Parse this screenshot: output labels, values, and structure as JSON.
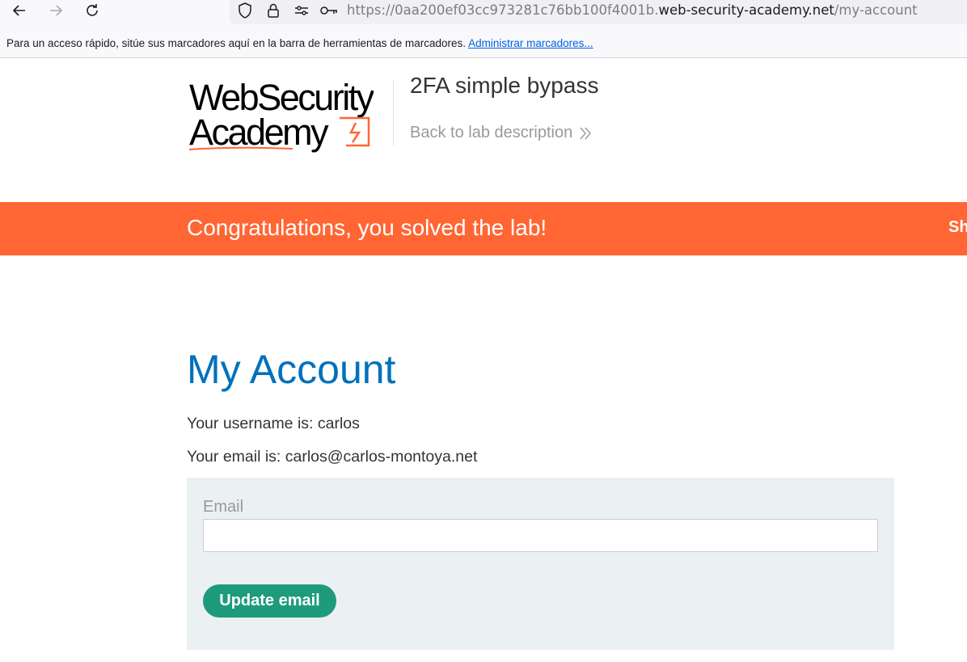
{
  "browser": {
    "url_prefix": "https://0aa200ef03cc973281c76bb100f4001b.",
    "url_domain": "web-security-academy.net",
    "url_path": "/my-account",
    "icons": [
      "back-arrow-icon",
      "forward-arrow-icon",
      "reload-icon",
      "shield-icon",
      "lock-icon",
      "permissions-icon",
      "key-icon"
    ]
  },
  "bookmarks_bar": {
    "message": "Para un acceso rápido, sitúe sus marcadores aquí en la barra de herramientas de marcadores.",
    "manage_link": "Administrar marcadores..."
  },
  "header": {
    "logo_line1": "WebSecurity",
    "logo_line2": "Academy",
    "lab_title": "2FA simple bypass",
    "back_link": "Back to lab description"
  },
  "banner": {
    "message": "Congratulations, you solved the lab!",
    "share_partial": "Sh"
  },
  "account": {
    "title": "My Account",
    "username_line": "Your username is: carlos",
    "email_line": "Your email is: carlos@carlos-montoya.net",
    "email_label": "Email",
    "email_value": "",
    "update_button": "Update email"
  },
  "colors": {
    "banner": "#ff6633",
    "heading": "#0071bc",
    "button": "#1e9b7b",
    "form_bg": "#ebf0f2"
  }
}
